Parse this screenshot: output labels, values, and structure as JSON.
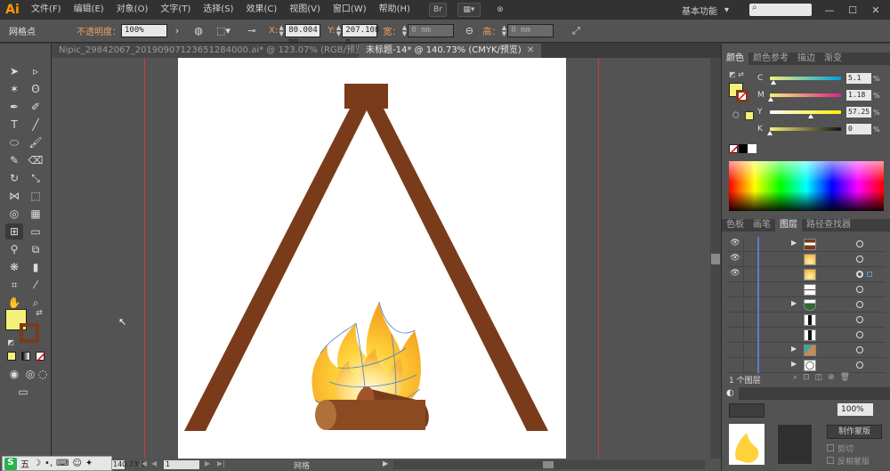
{
  "app": {
    "logo": "Ai"
  },
  "menubar": {
    "items": [
      "文件(F)",
      "编辑(E)",
      "对象(O)",
      "文字(T)",
      "选择(S)",
      "效果(C)",
      "视图(V)",
      "窗口(W)",
      "帮助(H)"
    ],
    "workspace": "基本功能",
    "workspace_arrow": "▾",
    "minimize": "—",
    "maximize": "☐",
    "close": "✕"
  },
  "controlbar": {
    "selection_label": "网格点",
    "opacity_label": "不透明度：",
    "opacity_value": "100%",
    "x_label": "X:",
    "x_value": "80.004 mm",
    "y_label": "Y:",
    "y_value": "207.108 m",
    "w_label": "宽：",
    "w_value": "0 mm",
    "h_label": "高：",
    "h_value": "0 mm"
  },
  "tabs": [
    {
      "label": "Nipic_29842067_20190907123651284000.ai* @ 123.07% (RGB/预览)",
      "close": "✕",
      "active": false
    },
    {
      "label": "未标题-14* @ 140.73% (CMYK/预览)",
      "close": "✕",
      "active": true
    }
  ],
  "statusbar": {
    "zoom": "140.73%",
    "page": "1",
    "tool_name": "网格"
  },
  "color_panel": {
    "tabs": [
      "颜色",
      "颜色参考",
      "描边",
      "渐变"
    ],
    "active_tab": "颜色",
    "channels": [
      {
        "label": "C",
        "value": "5.1",
        "unit": "%",
        "level": 0.051
      },
      {
        "label": "M",
        "value": "1.18",
        "unit": "%",
        "level": 0.0118
      },
      {
        "label": "Y",
        "value": "57.25",
        "unit": "%",
        "level": 0.5725
      },
      {
        "label": "K",
        "value": "0",
        "unit": "%",
        "level": 0
      }
    ],
    "fill_color": "#f5f07a"
  },
  "layers_panel": {
    "tabs": [
      "色板",
      "画笔",
      "图层",
      "路径查找器"
    ],
    "active_tab": "图层",
    "rows": [
      {
        "visible": true,
        "expand": true,
        "thumb": "brown",
        "selected": false
      },
      {
        "visible": true,
        "expand": false,
        "thumb": "flame",
        "selected": false
      },
      {
        "visible": true,
        "expand": false,
        "thumb": "flame",
        "selected": true
      },
      {
        "visible": false,
        "expand": false,
        "thumb": "white",
        "selected": false
      },
      {
        "visible": false,
        "expand": true,
        "thumb": "green",
        "selected": false
      },
      {
        "visible": false,
        "expand": false,
        "thumb": "stripe",
        "selected": false
      },
      {
        "visible": false,
        "expand": false,
        "thumb": "stripe",
        "selected": false
      },
      {
        "visible": false,
        "expand": true,
        "thumb": "multi",
        "selected": false
      },
      {
        "visible": false,
        "expand": true,
        "thumb": "circle",
        "selected": false
      }
    ],
    "footer_label": "1 个图层"
  },
  "transparency_panel": {
    "opacity_value": "100%",
    "make_mask_button": "制作蒙版",
    "clip_label": "剪切",
    "invert_label": "反相蒙版"
  },
  "colors": {
    "accent_orange": "#ff9a00",
    "tripod_brown": "#7a3b1a",
    "flame_yellow": "#ffd23a",
    "flame_orange": "#f5a623",
    "log_brown": "#8b4a22"
  }
}
